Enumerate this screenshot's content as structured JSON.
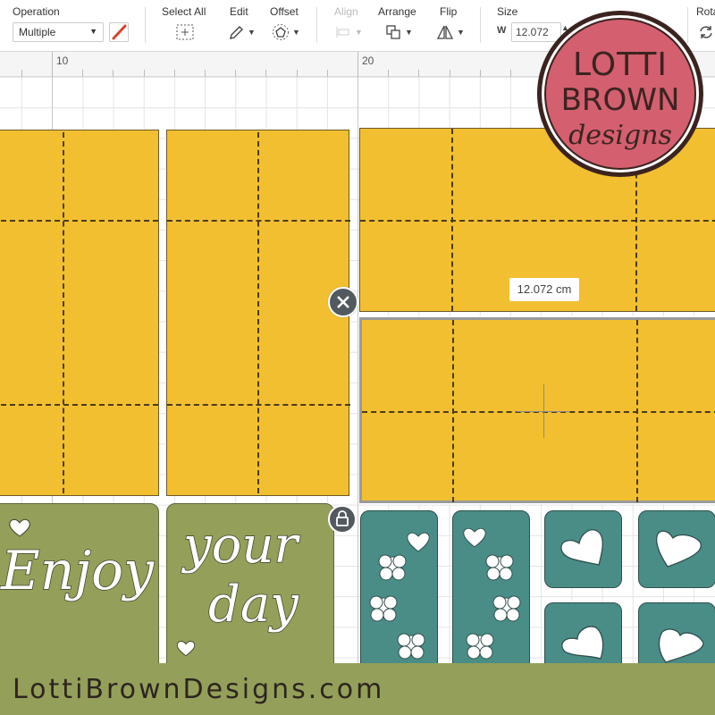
{
  "toolbar": {
    "operation": {
      "label": "Operation",
      "value": "Multiple",
      "pen_color": "#d9452b"
    },
    "select_all": {
      "label": "Select All"
    },
    "edit": {
      "label": "Edit"
    },
    "offset": {
      "label": "Offset"
    },
    "align": {
      "label": "Align",
      "disabled": true
    },
    "arrange": {
      "label": "Arrange"
    },
    "flip": {
      "label": "Flip"
    },
    "size": {
      "label": "Size",
      "w_label": "W",
      "w_value": "12.072"
    },
    "rotate": {
      "label": "Rota"
    }
  },
  "ruler": {
    "labels": [
      "10",
      "20"
    ]
  },
  "canvas": {
    "measurement_label": "12.072 cm",
    "yellow_color": "#f2bf30",
    "green_color": "#94a05a",
    "teal_color": "#4a8d87",
    "green_cards": [
      {
        "text": "Enjoy"
      },
      {
        "text_line1": "your",
        "text_line2": "day"
      }
    ]
  },
  "logo": {
    "line1": "LOTTI",
    "line2": "BROWN",
    "line3": "designs",
    "face_color": "#d35f6f"
  },
  "footer": {
    "text": "LottiBrownDesigns.com",
    "bg_color": "#94a05a"
  }
}
